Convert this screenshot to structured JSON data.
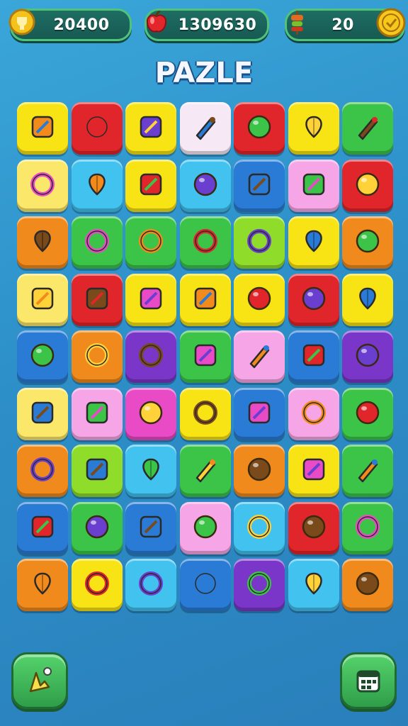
{
  "hud": {
    "score": "20400",
    "apples": "1309630",
    "coins": "20"
  },
  "title": "PAZLE",
  "colors": {
    "yellow": "#f8e315",
    "red": "#e0262b",
    "white": "#f6e9f5",
    "green": "#3cc449",
    "cyan": "#42c2ef",
    "blue": "#2a7bd6",
    "orange": "#f08a1c",
    "purple": "#7a36c8",
    "pink": "#f6a6e6",
    "lime": "#8fdc2a",
    "magenta": "#e94ac6",
    "lightyellow": "#fbe86a"
  },
  "grid": [
    [
      {
        "color": "yellow",
        "icon": "orange-ball-icon"
      },
      {
        "color": "red",
        "icon": "price-tag-icon"
      },
      {
        "color": "yellow",
        "icon": "shield-icon"
      },
      {
        "color": "white",
        "icon": "dropper-icon"
      },
      {
        "color": "red",
        "icon": "star-arrow-icon"
      },
      {
        "color": "yellow",
        "icon": "pen-icon"
      },
      {
        "color": "green",
        "icon": "compass-icon"
      }
    ],
    [
      {
        "color": "lightyellow",
        "icon": "leaf-icon"
      },
      {
        "color": "cyan",
        "icon": "red-ring-icon"
      },
      {
        "color": "yellow",
        "icon": "pencil-icon"
      },
      {
        "color": "cyan",
        "icon": "fruit-icon"
      },
      {
        "color": "blue",
        "icon": "purple-ball-icon"
      },
      {
        "color": "pink",
        "icon": "burger-icon"
      },
      {
        "color": "red",
        "icon": "chart-icon"
      }
    ],
    [
      {
        "color": "orange",
        "icon": "usb-icon"
      },
      {
        "color": "green",
        "icon": "tool-icon"
      },
      {
        "color": "green",
        "icon": "ring-icon"
      },
      {
        "color": "green",
        "icon": "gear-icon"
      },
      {
        "color": "lime",
        "icon": "sword-box-icon"
      },
      {
        "color": "yellow",
        "icon": "jar-icon"
      },
      {
        "color": "orange",
        "icon": "beach-ball-icon"
      }
    ],
    [
      {
        "color": "lightyellow",
        "icon": "wrench-icon"
      },
      {
        "color": "red",
        "icon": "planet-icon"
      },
      {
        "color": "yellow",
        "icon": "flower-icon"
      },
      {
        "color": "yellow",
        "icon": "chat-bubble-icon"
      },
      {
        "color": "yellow",
        "icon": "apple-icon"
      },
      {
        "color": "red",
        "icon": "green-gear-icon"
      },
      {
        "color": "yellow",
        "icon": "envelope-icon"
      }
    ],
    [
      {
        "color": "blue",
        "icon": "phone-icon"
      },
      {
        "color": "orange",
        "icon": "image-box-icon"
      },
      {
        "color": "purple",
        "icon": "dice-icon"
      },
      {
        "color": "green",
        "icon": "grapes-icon"
      },
      {
        "color": "pink",
        "icon": "balloon-icon"
      },
      {
        "color": "blue",
        "icon": "target-icon"
      },
      {
        "color": "purple",
        "icon": "green-leaf-icon"
      }
    ],
    [
      {
        "color": "lightyellow",
        "icon": "camera-icon"
      },
      {
        "color": "pink",
        "icon": "remote-icon"
      },
      {
        "color": "magenta",
        "icon": "cross-icon"
      },
      {
        "color": "yellow",
        "icon": "magnifier-icon"
      },
      {
        "color": "blue",
        "icon": "bottle-icon"
      },
      {
        "color": "pink",
        "icon": "lightning-icon"
      },
      {
        "color": "green",
        "icon": "bread-icon"
      }
    ],
    [
      {
        "color": "orange",
        "icon": "yarn-icon"
      },
      {
        "color": "lime",
        "icon": "pencil-icon"
      },
      {
        "color": "cyan",
        "icon": "cucumber-icon"
      },
      {
        "color": "green",
        "icon": "pumpkin-icon"
      },
      {
        "color": "orange",
        "icon": "cog-search-icon"
      },
      {
        "color": "yellow",
        "icon": "ticket-icon"
      },
      {
        "color": "green",
        "icon": "recycle-icon"
      }
    ],
    [
      {
        "color": "blue",
        "icon": "hammer-icon"
      },
      {
        "color": "green",
        "icon": "beans-icon"
      },
      {
        "color": "blue",
        "icon": "potion-icon"
      },
      {
        "color": "pink",
        "icon": "mango-icon"
      },
      {
        "color": "cyan",
        "icon": "lime-icon"
      },
      {
        "color": "red",
        "icon": "heart-icon"
      },
      {
        "color": "green",
        "icon": "bowl-icon"
      }
    ],
    [
      {
        "color": "orange",
        "icon": "box-icon"
      },
      {
        "color": "yellow",
        "icon": "game-card-icon"
      },
      {
        "color": "cyan",
        "icon": "bear-icon"
      },
      {
        "color": "blue",
        "icon": "note-icon"
      },
      {
        "color": "purple",
        "icon": "card-icon"
      },
      {
        "color": "cyan",
        "icon": "key-icon"
      },
      {
        "color": "orange",
        "icon": "chest-icon"
      }
    ]
  ],
  "buttons": {
    "hint_icon": "pointer-icon",
    "menu_icon": "calendar-icon"
  }
}
